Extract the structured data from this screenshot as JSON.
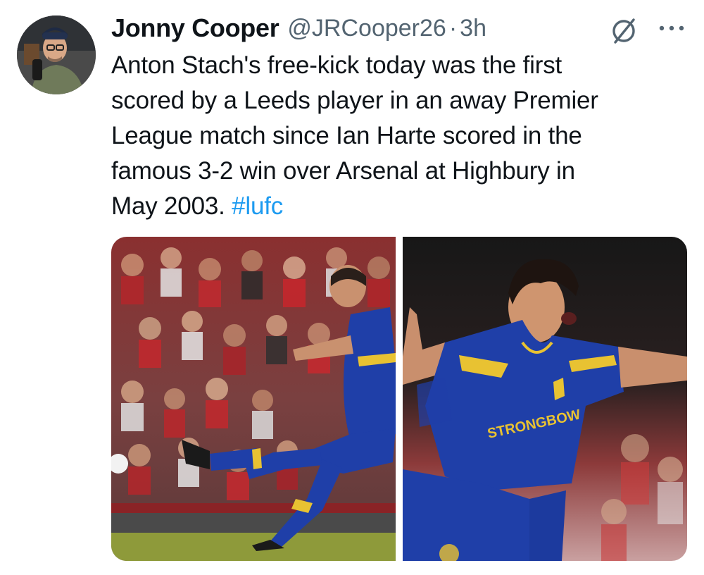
{
  "tweet": {
    "author": {
      "display_name": "Jonny Cooper",
      "handle": "@JRCooper26",
      "separator": "·",
      "time": "3h"
    },
    "text_lines": [
      "Anton Stach's free-kick today was the first",
      "scored by a Leeds player in an away Premier",
      "League match since Ian Harte scored in the",
      "famous 3-2 win over Arsenal at Highbury in",
      "May 2003. "
    ],
    "hashtag": "#lufc",
    "media": {
      "photos": [
        {
          "icon": "photo-free-kick"
        },
        {
          "icon": "photo-celebration",
          "shirt_sponsor": "STRONGBOW"
        }
      ]
    },
    "icons": {
      "grok": "grok-icon",
      "more": "more-options-icon"
    },
    "colors": {
      "text": "#0f1419",
      "secondary": "#536471",
      "link": "#1d9bf0",
      "kit_blue": "#1f3fa8",
      "kit_yellow": "#e8c232"
    }
  }
}
